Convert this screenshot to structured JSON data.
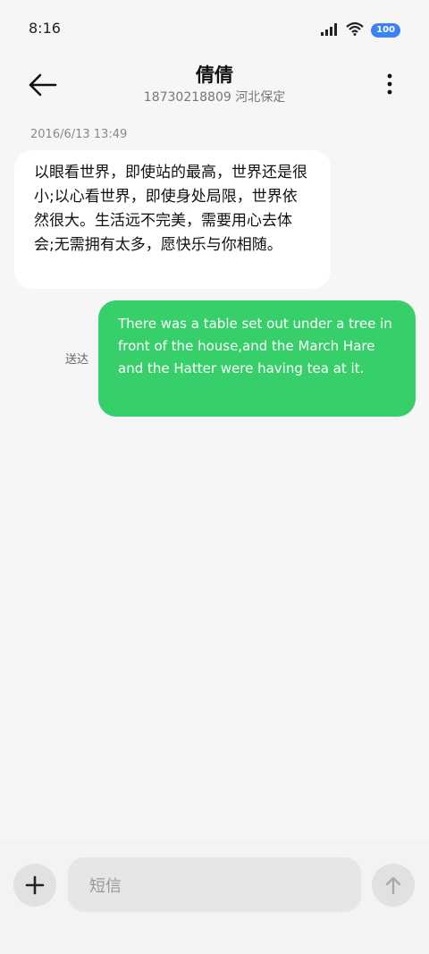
{
  "status": {
    "time": "8:16",
    "battery": "100",
    "icons": [
      "signal-icon",
      "wifi-icon",
      "battery-icon"
    ]
  },
  "header": {
    "title": "倩倩",
    "subtitle": "18730218809 河北保定"
  },
  "conversation": {
    "timestamp": "2016/6/13 13:49",
    "incoming_text": "以眼看世界，即使站的最高，世界还是很小;以心看世界，即使身处局限，世界依然很大。生活远不完美，需要用心去体会;无需拥有太多，愿快乐与你相随。",
    "outgoing_text": "There was a table set out under a tree in front of the house,and the March Hare and the Hatter were having tea at it.",
    "delivered_label": "送达"
  },
  "composer": {
    "placeholder": "短信"
  },
  "colors": {
    "outgoing_bubble": "#37cf69",
    "battery": "#3b82f6"
  }
}
